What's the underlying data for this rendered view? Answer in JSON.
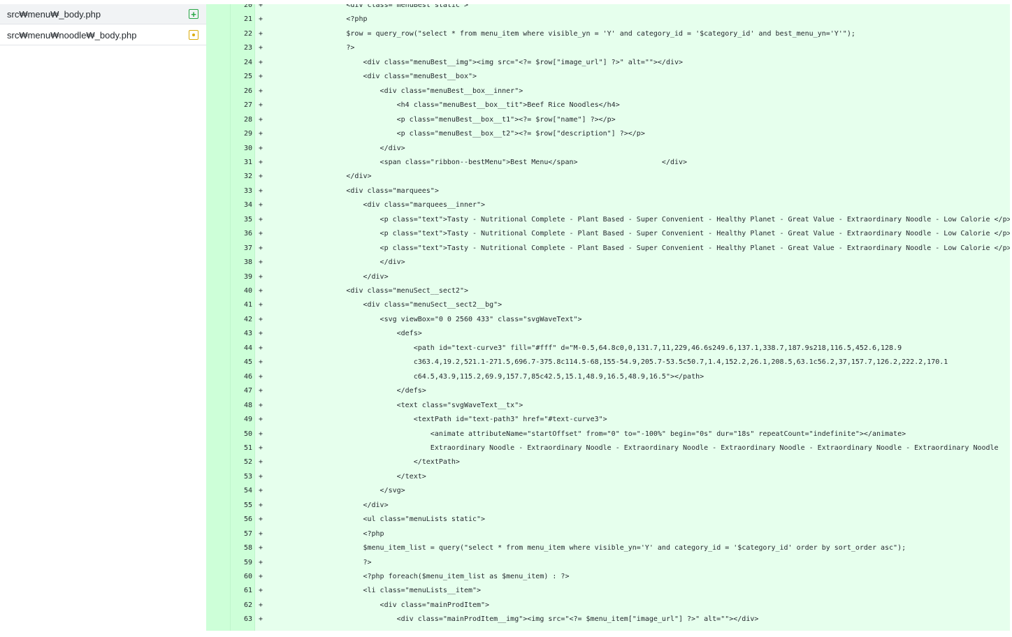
{
  "sidebar": {
    "files": [
      {
        "name": "src₩menu₩_body.php",
        "status": "added",
        "icon": "plus-square-icon"
      },
      {
        "name": "src₩menu₩noodle₩_body.php",
        "status": "modified",
        "icon": "dot-square-icon"
      }
    ]
  },
  "colors": {
    "added_bg": "#e6ffed",
    "gutter_bg": "#cdffd8",
    "added_icon": "#28a745",
    "modified_icon": "#dbab09"
  },
  "diff": {
    "lines": [
      {
        "n": "20",
        "indent": 20,
        "text": "<div class=\"menuBest static\">"
      },
      {
        "n": "21",
        "indent": 20,
        "text": "<?php"
      },
      {
        "n": "22",
        "indent": 20,
        "text": "$row = query_row(\"select * from menu_item where visible_yn = 'Y' and category_id = '$category_id' and best_menu_yn='Y'\");"
      },
      {
        "n": "23",
        "indent": 20,
        "text": "?>"
      },
      {
        "n": "24",
        "indent": 24,
        "text": "<div class=\"menuBest__img\"><img src=\"<?= $row[\"image_url\"] ?>\" alt=\"\"></div>"
      },
      {
        "n": "25",
        "indent": 24,
        "text": "<div class=\"menuBest__box\">"
      },
      {
        "n": "26",
        "indent": 28,
        "text": "<div class=\"menuBest__box__inner\">"
      },
      {
        "n": "27",
        "indent": 32,
        "text": "<h4 class=\"menuBest__box__tit\">Beef Rice Noodles</h4>"
      },
      {
        "n": "28",
        "indent": 32,
        "text": "<p class=\"menuBest__box__t1\"><?= $row[\"name\"] ?></p>"
      },
      {
        "n": "29",
        "indent": 32,
        "text": "<p class=\"menuBest__box__t2\"><?= $row[\"description\"] ?></p>"
      },
      {
        "n": "30",
        "indent": 28,
        "text": "</div>"
      },
      {
        "n": "31",
        "indent": 28,
        "text": "<span class=\"ribbon--bestMenu\">Best Menu</span>                    </div>"
      },
      {
        "n": "32",
        "indent": 20,
        "text": "</div>"
      },
      {
        "n": "33",
        "indent": 20,
        "text": "<div class=\"marquees\">"
      },
      {
        "n": "34",
        "indent": 24,
        "text": "<div class=\"marquees__inner\">"
      },
      {
        "n": "35",
        "indent": 28,
        "text": "<p class=\"text\">Tasty - Nutritional Complete - Plant Based - Super Convenient - Healthy Planet - Great Value - Extraordinary Noodle - Low Calorie </p>"
      },
      {
        "n": "36",
        "indent": 28,
        "text": "<p class=\"text\">Tasty - Nutritional Complete - Plant Based - Super Convenient - Healthy Planet - Great Value - Extraordinary Noodle - Low Calorie </p>"
      },
      {
        "n": "37",
        "indent": 28,
        "text": "<p class=\"text\">Tasty - Nutritional Complete - Plant Based - Super Convenient - Healthy Planet - Great Value - Extraordinary Noodle - Low Calorie </p>"
      },
      {
        "n": "38",
        "indent": 28,
        "text": "</div>"
      },
      {
        "n": "39",
        "indent": 24,
        "text": "</div>"
      },
      {
        "n": "40",
        "indent": 20,
        "text": "<div class=\"menuSect__sect2\">"
      },
      {
        "n": "41",
        "indent": 24,
        "text": "<div class=\"menuSect__sect2__bg\">"
      },
      {
        "n": "42",
        "indent": 28,
        "text": "<svg viewBox=\"0 0 2560 433\" class=\"svgWaveText\">"
      },
      {
        "n": "43",
        "indent": 32,
        "text": "<defs>"
      },
      {
        "n": "44",
        "indent": 36,
        "text": "<path id=\"text-curve3\" fill=\"#fff\" d=\"M-0.5,64.8c0,0,131.7,11,229,46.6s249.6,137.1,338.7,187.9s218,116.5,452.6,128.9"
      },
      {
        "n": "45",
        "indent": 36,
        "text": "c363.4,19.2,521.1-271.5,696.7-375.8c114.5-68,155-54.9,205.7-53.5c50.7,1.4,152.2,26.1,208.5,63.1c56.2,37,157.7,126.2,222.2,170.1"
      },
      {
        "n": "46",
        "indent": 36,
        "text": "c64.5,43.9,115.2,69.9,157.7,85c42.5,15.1,48.9,16.5,48.9,16.5\"></path>"
      },
      {
        "n": "47",
        "indent": 32,
        "text": "</defs>"
      },
      {
        "n": "48",
        "indent": 32,
        "text": "<text class=\"svgWaveText__tx\">"
      },
      {
        "n": "49",
        "indent": 36,
        "text": "<textPath id=\"text-path3\" href=\"#text-curve3\">"
      },
      {
        "n": "50",
        "indent": 40,
        "text": "<animate attributeName=\"startOffset\" from=\"0\" to=\"-100%\" begin=\"0s\" dur=\"18s\" repeatCount=\"indefinite\"></animate>"
      },
      {
        "n": "51",
        "indent": 40,
        "text": "Extraordinary Noodle - Extraordinary Noodle - Extraordinary Noodle - Extraordinary Noodle - Extraordinary Noodle - Extraordinary Noodle"
      },
      {
        "n": "52",
        "indent": 36,
        "text": "</textPath>"
      },
      {
        "n": "53",
        "indent": 32,
        "text": "</text>"
      },
      {
        "n": "54",
        "indent": 28,
        "text": "</svg>"
      },
      {
        "n": "55",
        "indent": 24,
        "text": "</div>"
      },
      {
        "n": "56",
        "indent": 24,
        "text": "<ul class=\"menuLists static\">"
      },
      {
        "n": "57",
        "indent": 24,
        "text": "<?php"
      },
      {
        "n": "58",
        "indent": 24,
        "text": "$menu_item_list = query(\"select * from menu_item where visible_yn='Y' and category_id = '$category_id' order by sort_order asc\");"
      },
      {
        "n": "59",
        "indent": 24,
        "text": "?>"
      },
      {
        "n": "60",
        "indent": 24,
        "text": "<?php foreach($menu_item_list as $menu_item) : ?>"
      },
      {
        "n": "61",
        "indent": 24,
        "text": "<li class=\"menuLists__item\">"
      },
      {
        "n": "62",
        "indent": 28,
        "text": "<div class=\"mainProdItem\">"
      },
      {
        "n": "63",
        "indent": 32,
        "text": "<div class=\"mainProdItem__img\"><img src=\"<?= $menu_item[\"image_url\"] ?>\" alt=\"\"></div>"
      }
    ]
  }
}
